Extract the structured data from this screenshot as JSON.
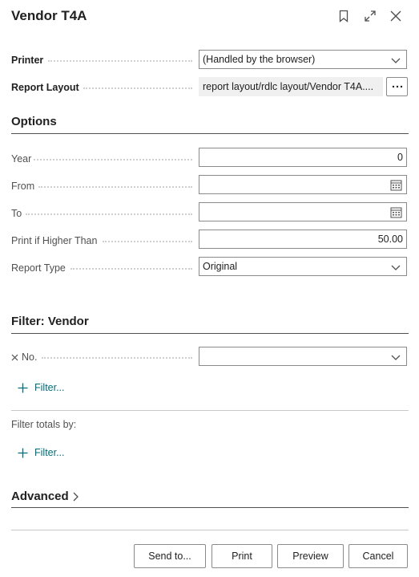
{
  "header": {
    "title": "Vendor T4A"
  },
  "fields": {
    "printer": {
      "label": "Printer",
      "value": "(Handled by the browser)"
    },
    "report_layout": {
      "label": "Report Layout",
      "value": "report layout/rdlc layout/Vendor T4A...."
    }
  },
  "options": {
    "title": "Options",
    "year": {
      "label": "Year",
      "value": "0"
    },
    "from": {
      "label": "From",
      "value": ""
    },
    "to": {
      "label": "To",
      "value": ""
    },
    "print_if_higher": {
      "label": "Print if Higher Than",
      "value": "50.00"
    },
    "report_type": {
      "label": "Report Type",
      "value": "Original"
    }
  },
  "filter_vendor": {
    "title": "Filter: Vendor",
    "no_label": "No.",
    "no_value": "",
    "add_filter": "Filter..."
  },
  "filter_totals": {
    "label": "Filter totals by:",
    "add_filter": "Filter..."
  },
  "advanced": {
    "title": "Advanced"
  },
  "buttons": {
    "send_to": "Send to...",
    "print": "Print",
    "preview": "Preview",
    "cancel": "Cancel"
  },
  "colors": {
    "accent": "#006d7a",
    "border": "#8a8a8a",
    "readonly_bg": "#f0f0f0"
  }
}
